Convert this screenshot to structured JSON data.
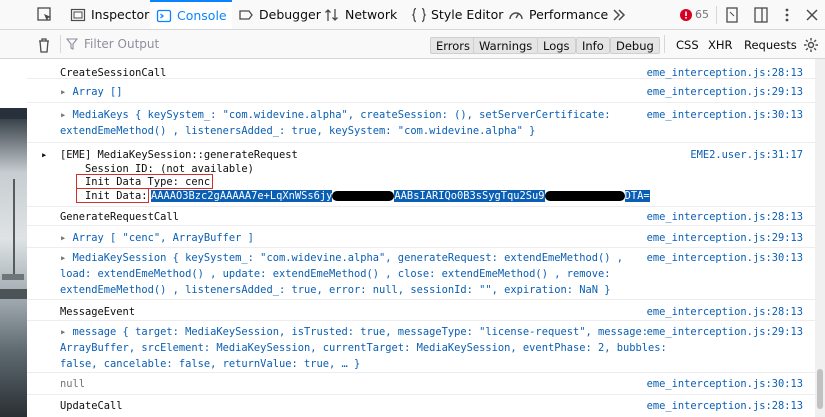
{
  "toolbar": {
    "tabs": [
      {
        "label": "Inspector",
        "icon": "inspector-icon"
      },
      {
        "label": "Console",
        "icon": "console-icon",
        "active": true
      },
      {
        "label": "Debugger",
        "icon": "debugger-icon"
      },
      {
        "label": "Network",
        "icon": "network-icon"
      },
      {
        "label": "Style Editor",
        "icon": "style-editor-icon"
      },
      {
        "label": "Performance",
        "icon": "performance-icon"
      }
    ],
    "error_count": "65",
    "accent": "#0a84ff"
  },
  "filterbar": {
    "placeholder": "Filter Output",
    "buttons": [
      "Errors",
      "Warnings",
      "Logs",
      "Info",
      "Debug"
    ],
    "extra": [
      "CSS",
      "XHR",
      "Requests"
    ]
  },
  "console": {
    "rows": [
      {
        "text": "CreateSessionCall",
        "src": "eme_interception.js:28:13"
      },
      {
        "text": "Array []",
        "src": "eme_interception.js:29:13"
      },
      {
        "line1": "MediaKeys { keySystem_: \"com.widevine.alpha\", createSession: (), setServerCertificate:",
        "line2": "extendEmeMethod() , listenersAdded_: true, keySystem: \"com.widevine.alpha\" }",
        "src": "eme_interception.js:30:13"
      },
      {
        "header": "[EME] MediaKeySession::generateRequest",
        "session": "Session ID: (not available)",
        "init_type": "Init Data Type: cenc",
        "init_label": "Init Data:",
        "init_value_a": "AAAAO3Bzc2gAAAAA7e+LqXnWSs6jy",
        "init_value_b": "AABsIARIQo0B3sSygTqu2Su9",
        "init_value_c": "DTA=",
        "src": "EME2.user.js:31:17"
      },
      {
        "text": "GenerateRequestCall",
        "src": "eme_interception.js:28:13"
      },
      {
        "text": "Array [ \"cenc\", ArrayBuffer ]",
        "src": "eme_interception.js:29:13"
      },
      {
        "line1": "MediaKeySession { keySystem_: \"com.widevine.alpha\", generateRequest: extendEmeMethod() ,",
        "line2": "load: extendEmeMethod() , update: extendEmeMethod() , close: extendEmeMethod() , remove:",
        "line3": "extendEmeMethod() , listenersAdded_: true, error: null, sessionId: \"\", expiration: NaN }",
        "src": "eme_interception.js:30:13"
      },
      {
        "text": "MessageEvent",
        "src": "eme_interception.js:28:13"
      },
      {
        "line1": "message { target: MediaKeySession, isTrusted: true, messageType: \"license-request\", message:",
        "line2": "ArrayBuffer, srcElement: MediaKeySession, currentTarget: MediaKeySession, eventPhase: 2, bubbles:",
        "line3": "false, cancelable: false, returnValue: true, … }",
        "src": "eme_interception.js:29:13"
      },
      {
        "text": "null",
        "src": "eme_interception.js:30:13"
      },
      {
        "text": "UpdateCall",
        "src": "eme_interception.js:28:13"
      }
    ]
  }
}
